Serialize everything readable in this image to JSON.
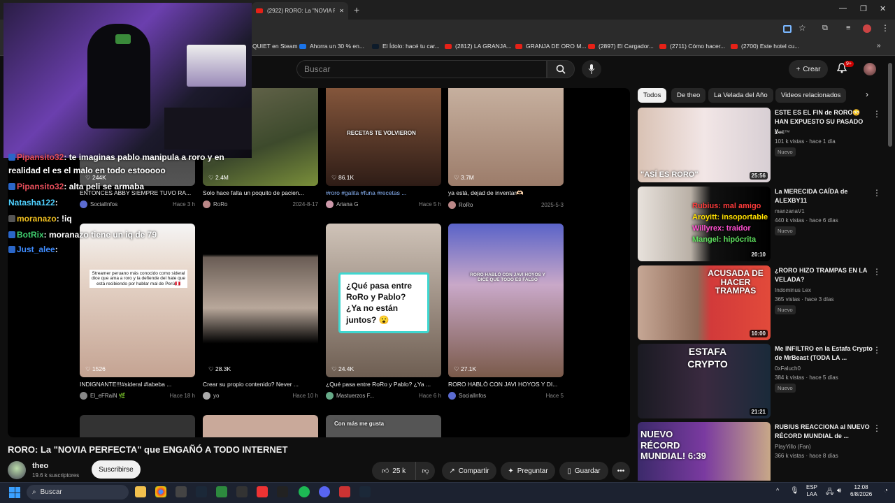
{
  "browser": {
    "tab_title": "(2922) RORO: La \"NOVIA PERFE",
    "bookmarks": [
      "QUIET en Steam",
      "Ahorra un 30 % en...",
      "El Ídolo: hacé tu car...",
      "(2812) LA GRANJA...",
      "GRANJA DE ORO M...",
      "(2897) El Cargador...",
      "(2711) Cómo hacer...",
      "(2700) Este hotel cu..."
    ]
  },
  "header": {
    "search_placeholder": "Buscar",
    "create_label": "Crear",
    "notif_count": "9+"
  },
  "chat": [
    {
      "user": "Pipansito32",
      "msg": ": te imaginas pablo manipula a roro y en",
      "color": "#e94e5b"
    },
    {
      "user": "",
      "msg": "realidad el es el malo en todo estooooo",
      "color": "#ffffff"
    },
    {
      "user": "Pipansito32",
      "msg": ": alta peli se armaba",
      "color": "#e94e5b"
    },
    {
      "user": "Natasha122",
      "msg": ":",
      "color": "#4fd1ff"
    },
    {
      "user": "moranazo",
      "msg": ": !iq",
      "color": "#f0c020"
    },
    {
      "user": "BotRix",
      "msg": ": moranazo tiene un iq de 79",
      "color": "#40d070"
    },
    {
      "user": "Just_alee",
      "msg": ":",
      "color": "#3f8cff"
    }
  ],
  "cards_row1": [
    {
      "likes": "♡ 244K",
      "title": "ENTONCES ABBY SIEMPRE TUVO RA...",
      "channel": "SocialInfos",
      "date": "Hace 3 h"
    },
    {
      "likes": "♡ 2.4M",
      "title": "Solo hace falta un poquito de pacien...",
      "channel": "RoRo",
      "date": "2024-8-17"
    },
    {
      "likes": "♡ 86.1K",
      "title": "#roro #galita #funa #recetas ...",
      "channel": "Ariana G",
      "date": "Hace 5 h",
      "overlay": "RECETAS TE VOLVIERON"
    },
    {
      "likes": "♡ 3.7M",
      "title": "ya está, dejad de inventar🫶🏻",
      "channel": "RoRo",
      "date": "2025-5-3"
    }
  ],
  "cards_row2": [
    {
      "likes": "♡ 1526",
      "title": "INDIGNANTE!!!#sideral #labeba ...",
      "channel": "El_eFRaiN 🌿",
      "date": "Hace 18 h",
      "overlay": "Streamer peruano más conocido como sideral dice que ama a roro y la defiende del hate que está recibiendo por hablar mal de Perú🇵🇪"
    },
    {
      "likes": "♡ 28.3K",
      "title": "Crear su propio contenido? Never ...",
      "channel": "yo",
      "date": "Hace 10 h"
    },
    {
      "likes": "♡ 24.4K",
      "title": "¿Qué pasa entre RoRo y Pablo? ¿Ya ...",
      "channel": "Mastuerzos F...",
      "date": "Hace 6 h",
      "overlay": "¿Qué pasa entre RoRo y Pablo? ¿Ya no están juntos? 😮"
    },
    {
      "likes": "♡ 27.1K",
      "title": "RORO HABLÓ CON JAVI HOYOS Y DI...",
      "channel": "SocialInfos",
      "date": "Hace 5",
      "overlay": "RORO HABLÓ CON JAVI HOYOS Y DICE QUE TODO ES FALSO"
    }
  ],
  "row3_overlay": "Con más me gusta",
  "video": {
    "title": "RORO: La \"NOVIA PERFECTA\" que ENGAÑÓ A TODO INTERNET",
    "channel": "theo",
    "subs": "19.6 k suscriptores",
    "subscribe": "Suscribirse",
    "likes": "25 k",
    "share": "Compartir",
    "ask": "Preguntar",
    "save": "Guardar"
  },
  "chips": [
    "Todos",
    "De theo",
    "La Velada del Año",
    "Videos relacionados"
  ],
  "recs": [
    {
      "title": "ESTE ES EL FIN de RORO😳 HAN EXPUESTO SU PASADO y...",
      "channel": "Cell™",
      "meta": "101 k vistas · hace 1 día",
      "badge": "Nuevo",
      "duration": "25:56",
      "overlay": "\"ASÍ ES RORO\""
    },
    {
      "title": "La MERECIDA CAÍDA de ALEXBY11",
      "channel": "manzanaV1",
      "meta": "440 k vistas · hace 6 días",
      "badge": "Nuevo",
      "duration": "20:10",
      "overlay_lines": [
        "Rubius: mal amigo",
        "Aroyitt: insoportable",
        "Willyrex: traidor",
        "Mangel: hipócrita"
      ]
    },
    {
      "title": "¿RORO HIZO TRAMPAS EN LA VELADA?",
      "channel": "Indominus Lex",
      "meta": "365 vistas · hace 3 días",
      "badge": "Nuevo",
      "duration": "10:00",
      "overlay": "ACUSADA DE HACER TRAMPAS"
    },
    {
      "title": "Me INFILTRO en la Estafa Crypto de MrBeast (TODA LA ...",
      "channel": "0xFaluch0",
      "meta": "384 k vistas · hace 5 días",
      "badge": "Nuevo",
      "duration": "21:21",
      "overlay": "ESTAFA CRYPTO"
    },
    {
      "title": "RUBIUS REACCIONA al NUEVO RÉCORD MUNDIAL de ...",
      "channel": "PlayYillo (Fan)",
      "meta": "366 k vistas · hace 8 días",
      "badge": "",
      "duration": "",
      "overlay": "NUEVO RÉCORD MUNDIAL! 6:39"
    }
  ],
  "taskbar": {
    "search": "Buscar",
    "lang": "ESP",
    "lang2": "LAA",
    "time": "12:08",
    "date": "6/8/2026"
  }
}
